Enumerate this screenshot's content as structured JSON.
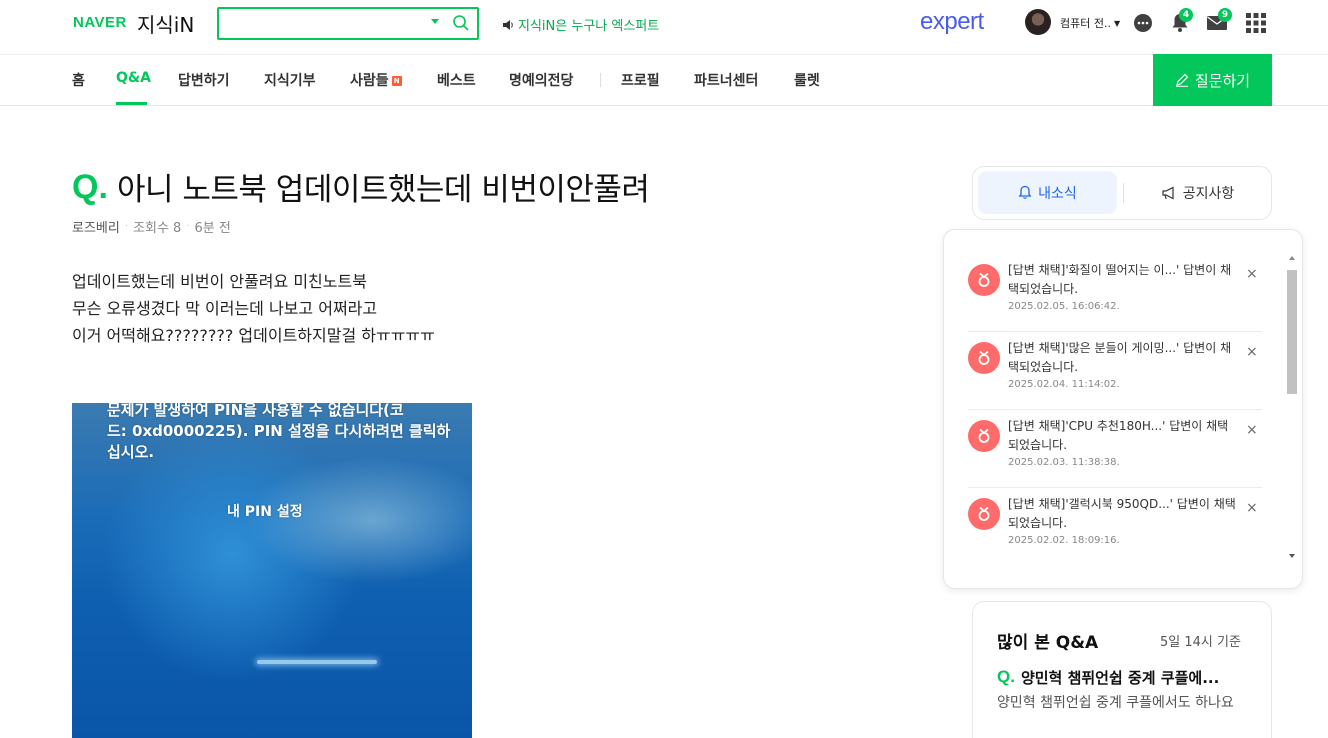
{
  "header": {
    "naver_logo": "NAVER",
    "kin_logo": "지식iN",
    "search_value": "",
    "promo_text": "지식iN은 누구나 엑스퍼트",
    "expert_logo": "expert",
    "username": "컴퓨터 전..",
    "notification_count": "4",
    "mail_count": "9"
  },
  "nav": {
    "items": [
      "홈",
      "Q&A",
      "답변하기",
      "지식기부",
      "사람들",
      "베스트",
      "명예의전당",
      "프로필",
      "파트너센터",
      "룰렛"
    ],
    "active": "Q&A",
    "new_badge": "N",
    "ask_button": "질문하기"
  },
  "question": {
    "mark": "Q.",
    "title": "아니 노트북 업데이트했는데 비번이안풀려",
    "author": "로즈베리",
    "views": "조회수 8",
    "time": "6분 전",
    "body": [
      "업데이트했는데 비번이 안풀려요 미친노트북",
      "무슨 오류생겼다 막 이러는데 나보고 어쩌라고",
      "이거 어떡해요???????? 업데이트하지말걸 하ㅠㅠㅠㅠ"
    ],
    "image_text": {
      "line1": "문제가 발생하여 PIN을 사용할 수 없습니다(코",
      "line2": "드: 0xd0000225). PIN 설정을 다시하려면 클릭하",
      "line3": "십시오.",
      "pin_link": "내 PIN 설정"
    }
  },
  "side_tabs": {
    "news": "내소식",
    "notice": "공지사항"
  },
  "notifications": [
    {
      "text": "[답변 채택]'화질이 떨어지는 이...' 답변이 채택되었습니다.",
      "time": "2025.02.05. 16:06:42."
    },
    {
      "text": "[답변 채택]'많은 분들이 게이밍...' 답변이 채택되었습니다.",
      "time": "2025.02.04. 11:14:02."
    },
    {
      "text": "[답변 채택]'CPU 추천180H...' 답변이 채택되었습니다.",
      "time": "2025.02.03. 11:38:38."
    },
    {
      "text": "[답변 채택]'갤럭시북 950QD...' 답변이 채택되었습니다.",
      "time": "2025.02.02. 18:09:16."
    }
  ],
  "popular": {
    "title": "많이 본 Q&A",
    "date": "5일 14시 기준",
    "q_mark": "Q.",
    "item_title": "양민혁 챔퓌언쉽 중계 쿠플에...",
    "item_sub": "양민혁 챔퓌언쉽 중계 쿠플에서도 하나요"
  },
  "colors": {
    "brand_green": "#03c75a",
    "expert_blue": "#4a5cf0",
    "notice_red": "#ff6b6b",
    "tab_active_blue": "#2463eb"
  }
}
